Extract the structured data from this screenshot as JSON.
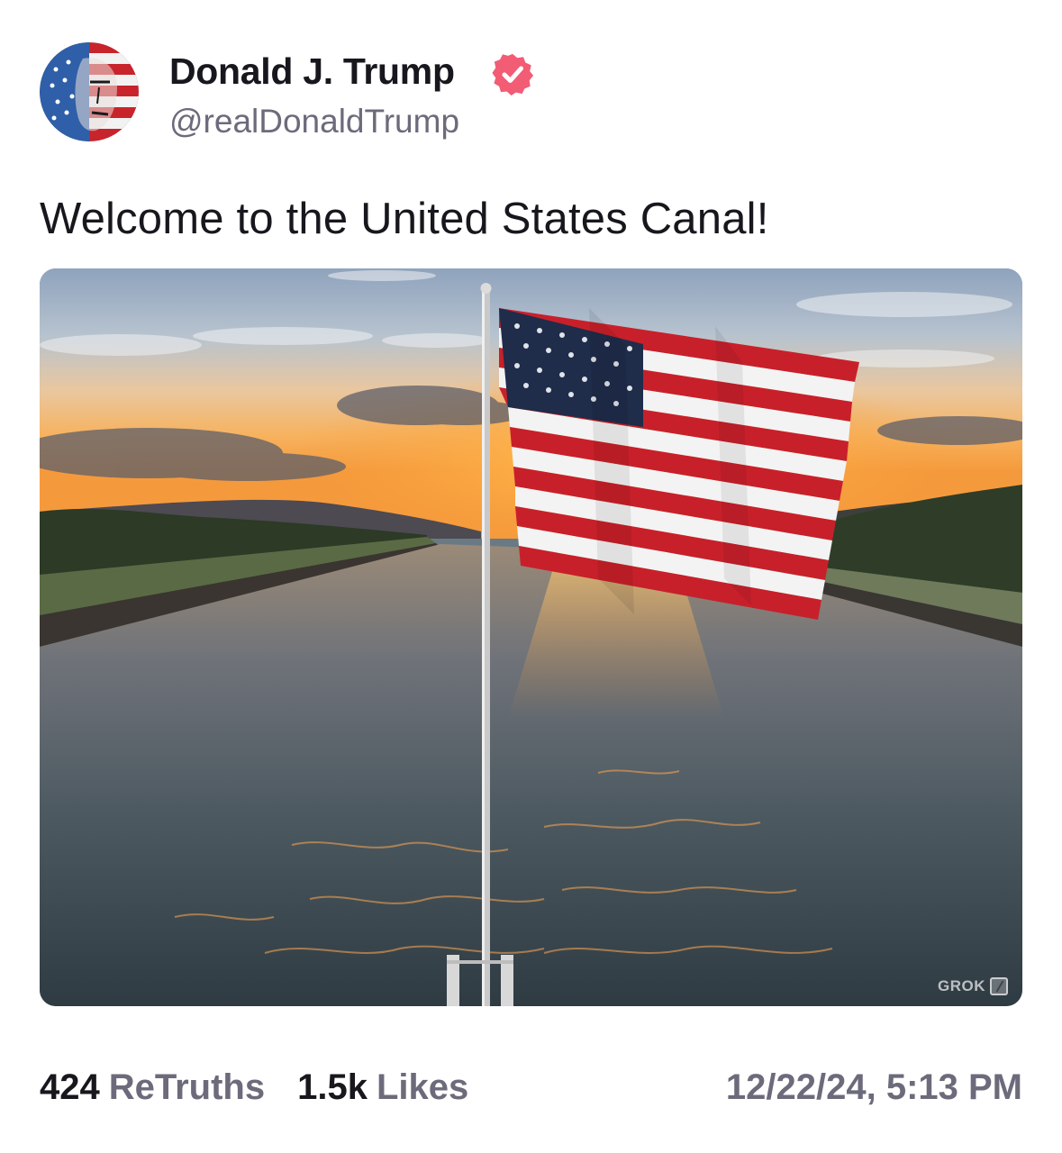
{
  "author": {
    "display_name": "Donald J. Trump",
    "handle": "@realDonaldTrump",
    "verified": true,
    "avatar_icon": "flag-painted-portrait-avatar",
    "verified_icon": "verified-badge-icon",
    "verified_color": "#f25c75"
  },
  "post": {
    "text": "Welcome to the United States Canal!",
    "image_description_icon": "canal-sunset-american-flag-image",
    "watermark": "GROK"
  },
  "stats": {
    "retruths_count": "424",
    "retruths_label": "ReTruths",
    "likes_count": "1.5k",
    "likes_label": "Likes",
    "timestamp": "12/22/24, 5:13 PM"
  },
  "colors": {
    "text_primary": "#17171d",
    "text_secondary": "#6b6b7b",
    "accent": "#f25c75"
  }
}
